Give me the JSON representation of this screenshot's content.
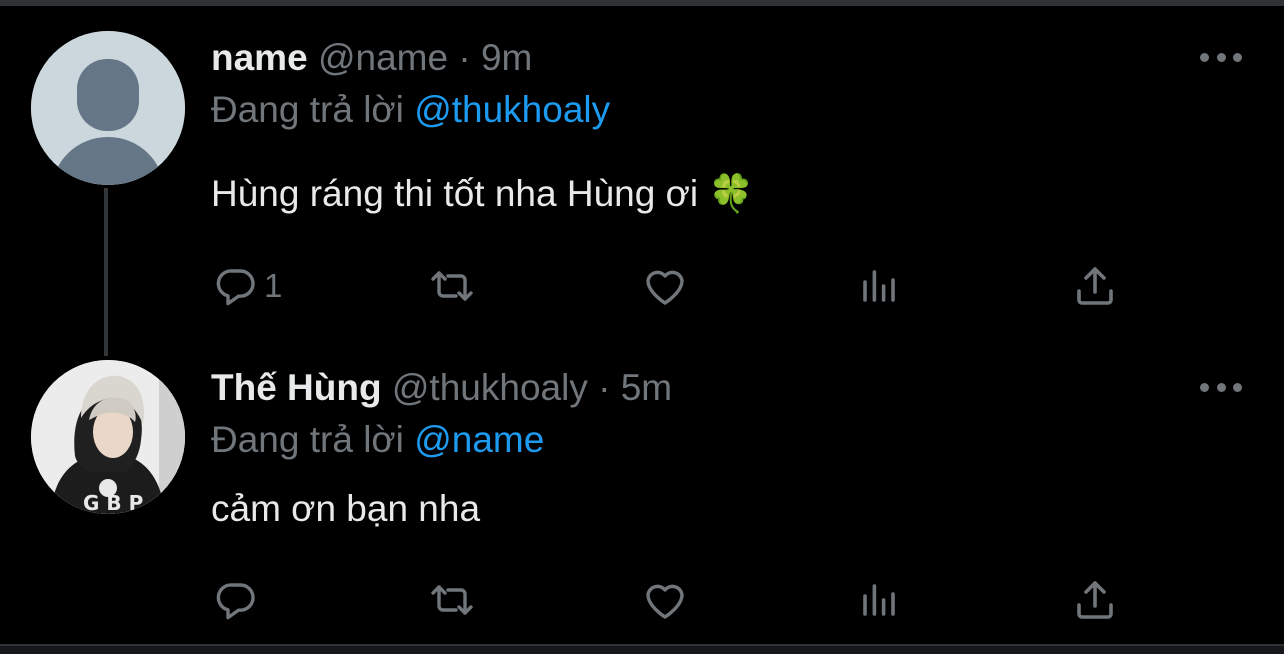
{
  "tweets": [
    {
      "display_name": "name",
      "handle": "@name",
      "separator": "·",
      "time": "9m",
      "replying_prefix": "Đang trả lời",
      "replying_to": "@thukhoaly",
      "text": "Hùng ráng thi tốt nha Hùng ơi 🍀",
      "reply_count": "1"
    },
    {
      "display_name": "Thế Hùng",
      "handle": "@thukhoaly",
      "separator": "·",
      "time": "5m",
      "replying_prefix": "Đang trả lời",
      "replying_to": "@name",
      "text": "cảm ơn bạn nha",
      "reply_count": ""
    }
  ],
  "icons": {
    "reply": "reply-icon",
    "retweet": "retweet-icon",
    "like": "heart-icon",
    "analytics": "analytics-icon",
    "share": "share-icon",
    "more": "more-icon"
  },
  "colors": {
    "background": "#000000",
    "text_primary": "#e7e9ea",
    "text_secondary": "#71767b",
    "accent": "#1d9bf0"
  }
}
